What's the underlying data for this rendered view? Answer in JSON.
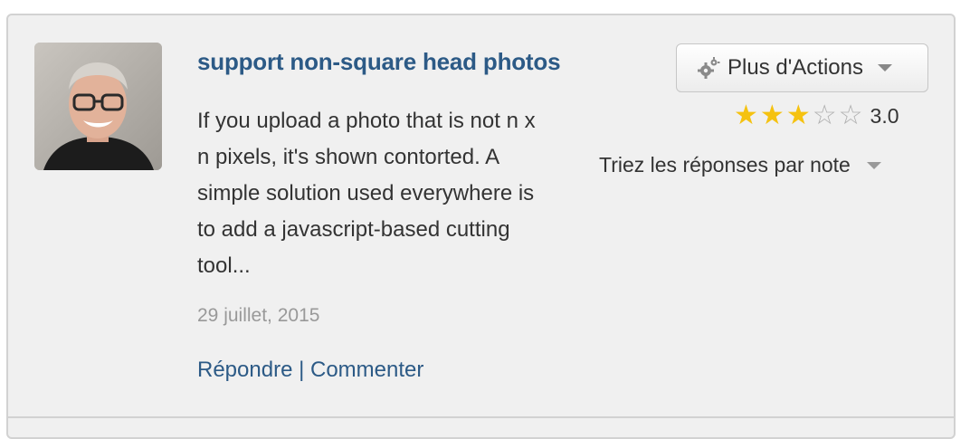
{
  "post": {
    "title": "support non-square head photos",
    "body_lines": [
      "If you upload a photo that is not n x",
      "n pixels, it's shown contorted. A",
      "simple solution used everywhere is",
      "to add a javascript-based cutting",
      "tool..."
    ],
    "date": "29 juillet, 2015",
    "reply_label": "Répondre",
    "separator": "|",
    "comment_label": "Commenter"
  },
  "actions": {
    "label": "Plus d'Actions",
    "icon": "gear-icon"
  },
  "rating": {
    "value_label": "3.0",
    "stars_filled": 3,
    "stars_total": 5,
    "filled_color": "#f5c211",
    "empty_color": "#b0b0b0"
  },
  "sort": {
    "label": "Triez les réponses par note"
  },
  "colors": {
    "link": "#2c5a86",
    "card_background": "#f0f0f0",
    "muted_text": "#999999"
  }
}
